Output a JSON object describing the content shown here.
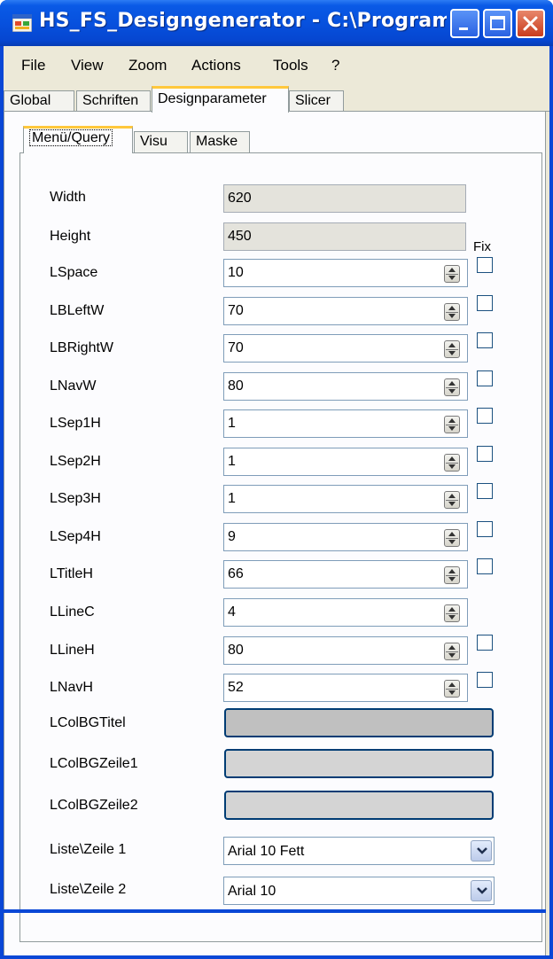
{
  "window": {
    "title": "HS_FS_Designgenerator - C:\\Programme\\Gl...",
    "icon": "app-icon",
    "controls": [
      "minimize-icon",
      "maximize-icon",
      "close-icon"
    ]
  },
  "menu": [
    "File",
    "View",
    "Zoom",
    "Actions",
    "Tools",
    "?"
  ],
  "tabs": [
    "Global",
    "Schriften",
    "Designparameter",
    "Slicer"
  ],
  "active_tab": "Designparameter",
  "subtabs": [
    "Menü/Query",
    "Visu",
    "Maske"
  ],
  "active_subtab": "Menü/Query",
  "fix_label": "Fix",
  "readonly_fields": [
    {
      "label": "Width",
      "value": "620"
    },
    {
      "label": "Height",
      "value": "450"
    }
  ],
  "numeric_fields": [
    {
      "label": "LSpace",
      "value": "10",
      "fix": false
    },
    {
      "label": "LBLeftW",
      "value": "70",
      "fix": false
    },
    {
      "label": "LBRightW",
      "value": "70",
      "fix": false
    },
    {
      "label": "LNavW",
      "value": "80",
      "fix": false
    },
    {
      "label": "LSep1H",
      "value": "1",
      "fix": false
    },
    {
      "label": "LSep2H",
      "value": "1",
      "fix": false
    },
    {
      "label": "LSep3H",
      "value": "1",
      "fix": false
    },
    {
      "label": "LSep4H",
      "value": "9",
      "fix": false
    },
    {
      "label": "LTitleH",
      "value": "66",
      "fix": false
    },
    {
      "label": "LLineC",
      "value": "4"
    },
    {
      "label": "LLineH",
      "value": "80",
      "fix": false
    },
    {
      "label": "LNavH",
      "value": "52",
      "fix": false
    }
  ],
  "color_fields": [
    {
      "label": "LColBGTitel",
      "color": "#c0c0c0"
    },
    {
      "label": "LColBGZeile1",
      "color": "#d4d4d4"
    },
    {
      "label": "LColBGZeile2",
      "color": "#d4d4d4"
    }
  ],
  "font_fields": [
    {
      "label": "Liste\\Zeile 1",
      "value": "Arial 10 Fett"
    },
    {
      "label": "Liste\\Zeile 2",
      "value": "Arial 10"
    }
  ],
  "colors": {
    "titlebar": "#0751de",
    "face": "#ece9d8",
    "active_tab_accent": "#ffc83c"
  }
}
